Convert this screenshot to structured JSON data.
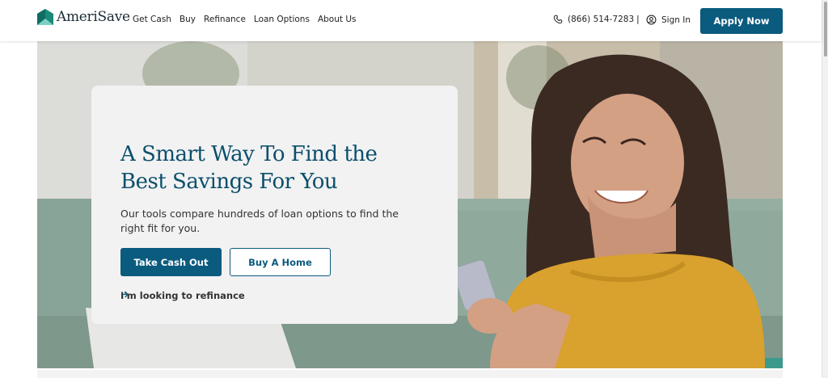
{
  "brand": {
    "name": "AmeriSave",
    "color": "#0b5b7f",
    "logo_teal": "#1a8a7a"
  },
  "nav": {
    "items": [
      {
        "label": "Get Cash"
      },
      {
        "label": "Buy"
      },
      {
        "label": "Refinance"
      },
      {
        "label": "Loan Options"
      },
      {
        "label": "About Us"
      }
    ]
  },
  "header": {
    "phone": "(866) 514-7283",
    "separator": "|",
    "sign_in": "Sign In",
    "apply_now": "Apply Now",
    "phone_icon": "phone-icon",
    "user_icon": "user-circle-icon"
  },
  "hero": {
    "title": "A Smart Way To Find the Best Savings For You",
    "subtitle": "Our tools compare hundreds of loan options to find the right fit for you.",
    "primary_button": "Take Cash Out",
    "secondary_button": "Buy A Home",
    "refinance_link": "I'm looking to refinance",
    "arrow_icon": "arrow-right-icon",
    "photo_description_icon": "hero-photo"
  }
}
